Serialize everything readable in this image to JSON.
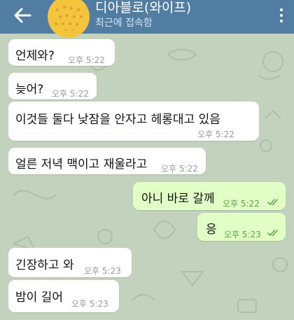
{
  "header": {
    "title": "디아블로(와이프)",
    "status": "최근에 접속함"
  },
  "messages": [
    {
      "text": "언제와?",
      "time": "오후 5:22",
      "direction": "in"
    },
    {
      "text": "늦어?",
      "time": "오후 5:22",
      "direction": "in"
    },
    {
      "text": "이것들 둘다 낮잠을 안자고 헤롱대고 있음",
      "time": "오후 5:22",
      "direction": "in"
    },
    {
      "text": "얼른 저녁 맥이고 재울라고",
      "time": "오후 5:22",
      "direction": "in"
    },
    {
      "text": "아니 바로 갈께",
      "time": "오후 5:22",
      "direction": "out",
      "read": true
    },
    {
      "text": "응",
      "time": "오후 5:23",
      "direction": "out",
      "read": true
    },
    {
      "text": "긴장하고 와",
      "time": "오후 5:23",
      "direction": "in"
    },
    {
      "text": "밤이 길어",
      "time": "오후 5:23",
      "direction": "in"
    }
  ],
  "colors": {
    "header": "#527da3",
    "background": "#c2d2bd",
    "incoming_bubble": "#ffffff",
    "outgoing_bubble": "#e1fec6",
    "read_check": "#5ea548",
    "avatar": "#f4c43d"
  },
  "icons": {
    "back": "arrow-left-icon",
    "menu": "more-vertical-icon",
    "read": "double-check-icon"
  }
}
